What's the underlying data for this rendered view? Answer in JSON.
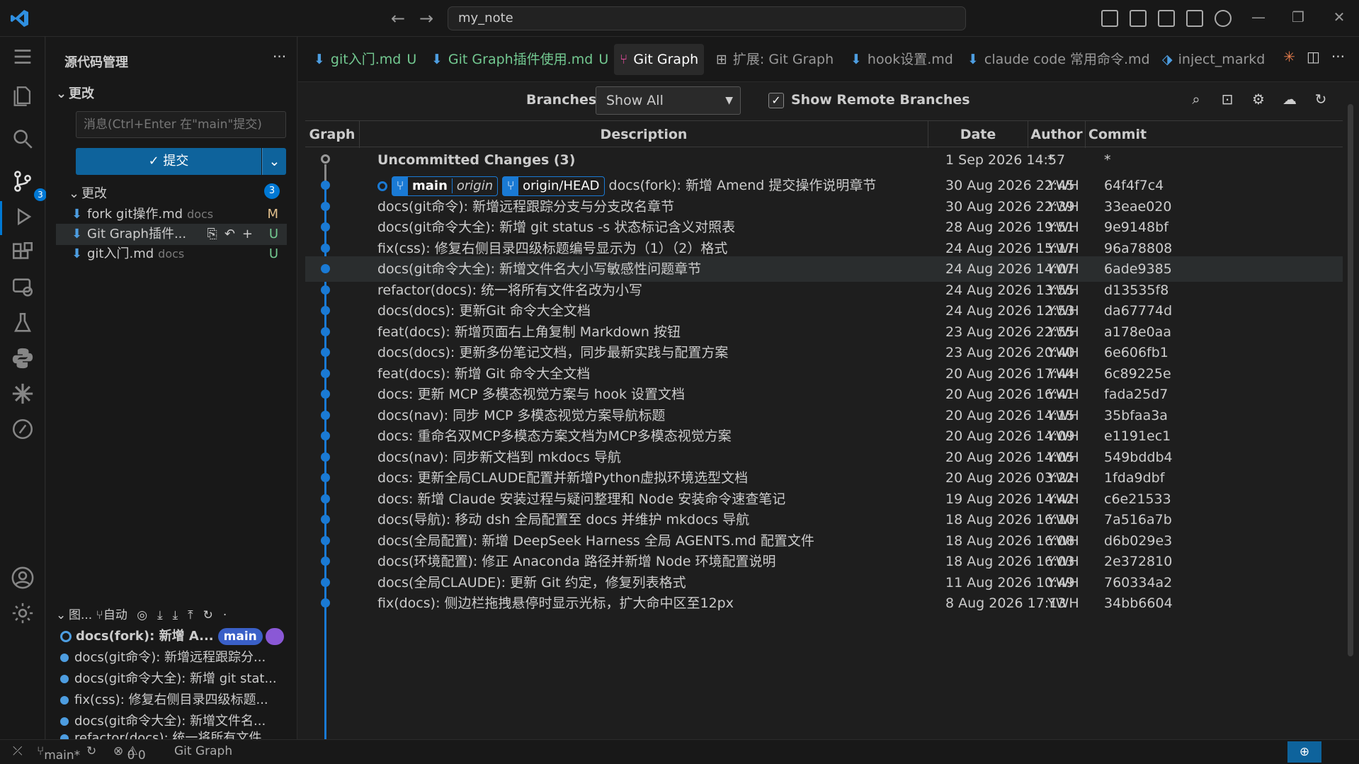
{
  "titlebar": {
    "back": "←",
    "forward": "→",
    "command_center": "my_note",
    "min": "—",
    "max": "❐",
    "close": "✕"
  },
  "activity": {
    "scm_badge": "3"
  },
  "sidebar": {
    "title": "源代码管理",
    "more": "···",
    "section": "更改",
    "message_placeholder": "消息(Ctrl+Enter 在\"main\"提交)",
    "commit_label": "✓ 提交",
    "changes_header": "更改",
    "changes_count": "3",
    "files": [
      {
        "name": "fork git操作.md",
        "dir": "docs",
        "status": "M"
      },
      {
        "name": "Git Graph插件...",
        "dir": "",
        "status": "U"
      },
      {
        "name": "git入门.md",
        "dir": "docs",
        "status": "U"
      }
    ],
    "graph_header": "图...",
    "graph_auto": "自动",
    "graph_rows": [
      {
        "text": "docs(fork): 新增 A...",
        "pill": "main"
      },
      {
        "text": "docs(git命令): 新增远程跟踪分..."
      },
      {
        "text": "docs(git命令大全): 新增 git stat..."
      },
      {
        "text": "fix(css): 修复右侧目录四级标题..."
      },
      {
        "text": "docs(git命令大全): 新增文件名..."
      },
      {
        "text": "refactor(docs): 统一将所有文件..."
      }
    ]
  },
  "tabs": [
    {
      "label": "git入门.md",
      "flag": "U"
    },
    {
      "label": "Git Graph插件使用.md",
      "flag": "U"
    },
    {
      "label": "Git Graph"
    },
    {
      "label": "扩展: Git Graph"
    },
    {
      "label": "hook设置.md"
    },
    {
      "label": "claude code 常用命令.md"
    },
    {
      "label": "inject_markd"
    }
  ],
  "controls": {
    "branches_label": "Branches:",
    "branches_value": "Show All",
    "show_remote": "Show Remote Branches"
  },
  "table": {
    "headers": {
      "graph": "Graph",
      "description": "Description",
      "date": "Date",
      "author": "Author",
      "commit": "Commit"
    },
    "uncommitted": {
      "desc": "Uncommitted Changes (3)",
      "date": "1 Sep 2026 14:57",
      "author": "*",
      "commit": "*"
    },
    "refs": {
      "branch": "main",
      "remote": "origin",
      "head": "origin/HEAD"
    },
    "rows": [
      {
        "desc": "docs(fork): 新增 Amend 提交操作说明章节",
        "date": "30 Aug 2026 22:45",
        "author": "YWH",
        "commit": "64f4f7c4"
      },
      {
        "desc": "docs(git命令): 新增远程跟踪分支与分支改名章节",
        "date": "30 Aug 2026 22:39",
        "author": "YWH",
        "commit": "33eae020"
      },
      {
        "desc": "docs(git命令大全): 新增 git status -s 状态标记含义对照表",
        "date": "28 Aug 2026 19:51",
        "author": "YWH",
        "commit": "9e9148bf"
      },
      {
        "desc": "fix(css): 修复右侧目录四级标题编号显示为（1）（2）格式",
        "date": "24 Aug 2026 15:17",
        "author": "YWH",
        "commit": "96a78808"
      },
      {
        "desc": "docs(git命令大全): 新增文件名大小写敏感性问题章节",
        "date": "24 Aug 2026 14:07",
        "author": "YWH",
        "commit": "6ade9385"
      },
      {
        "desc": "refactor(docs): 统一将所有文件名改为小写",
        "date": "24 Aug 2026 13:55",
        "author": "YWH",
        "commit": "d13535f8"
      },
      {
        "desc": "docs(docs): 更新Git 命令大全文档",
        "date": "24 Aug 2026 12:53",
        "author": "YWH",
        "commit": "da67774d"
      },
      {
        "desc": "feat(docs): 新增页面右上角复制 Markdown 按钮",
        "date": "23 Aug 2026 22:55",
        "author": "YWH",
        "commit": "a178e0aa"
      },
      {
        "desc": "docs(docs): 更新多份笔记文档，同步最新实践与配置方案",
        "date": "23 Aug 2026 20:40",
        "author": "YWH",
        "commit": "6e606fb1"
      },
      {
        "desc": "feat(docs): 新增 Git 命令大全文档",
        "date": "20 Aug 2026 17:44",
        "author": "YWH",
        "commit": "6c89225e"
      },
      {
        "desc": "docs: 更新 MCP 多模态视觉方案与 hook 设置文档",
        "date": "20 Aug 2026 16:41",
        "author": "YWH",
        "commit": "fada25d7"
      },
      {
        "desc": "docs(nav): 同步 MCP 多模态视觉方案导航标题",
        "date": "20 Aug 2026 14:15",
        "author": "YWH",
        "commit": "35bfaa3a"
      },
      {
        "desc": "docs: 重命名双MCP多模态方案文档为MCP多模态视觉方案",
        "date": "20 Aug 2026 14:09",
        "author": "YWH",
        "commit": "e1191ec1"
      },
      {
        "desc": "docs(nav): 同步新文档到 mkdocs 导航",
        "date": "20 Aug 2026 14:05",
        "author": "YWH",
        "commit": "549bddb4"
      },
      {
        "desc": "docs: 更新全局CLAUDE配置并新增Python虚拟环境选型文档",
        "date": "20 Aug 2026 03:22",
        "author": "YWH",
        "commit": "1fda9dbf"
      },
      {
        "desc": "docs: 新增 Claude 安装过程与疑问整理和 Node 安装命令速查笔记",
        "date": "19 Aug 2026 14:42",
        "author": "YWH",
        "commit": "c6e21533"
      },
      {
        "desc": "docs(导航): 移动 dsh 全局配置至 docs 并维护 mkdocs 导航",
        "date": "18 Aug 2026 16:10",
        "author": "YWH",
        "commit": "7a516a7b"
      },
      {
        "desc": "docs(全局配置): 新增 DeepSeek Harness 全局 AGENTS.md 配置文件",
        "date": "18 Aug 2026 16:08",
        "author": "YWH",
        "commit": "d6b029e3"
      },
      {
        "desc": "docs(环境配置): 修正 Anaconda 路径并新增 Node 环境配置说明",
        "date": "18 Aug 2026 16:03",
        "author": "YWH",
        "commit": "2e372810"
      },
      {
        "desc": "docs(全局CLAUDE): 更新 Git 约定，修复列表格式",
        "date": "11 Aug 2026 10:49",
        "author": "YWH",
        "commit": "760334a2"
      },
      {
        "desc": "fix(docs): 侧边栏拖拽悬停时显示光标，扩大命中区至12px",
        "date": "8 Aug 2026 17:13",
        "author": "YWH",
        "commit": "34bb6604"
      }
    ]
  },
  "status": {
    "branch": "main*",
    "errors": "0",
    "warnings": "0",
    "graph": "Git Graph"
  }
}
